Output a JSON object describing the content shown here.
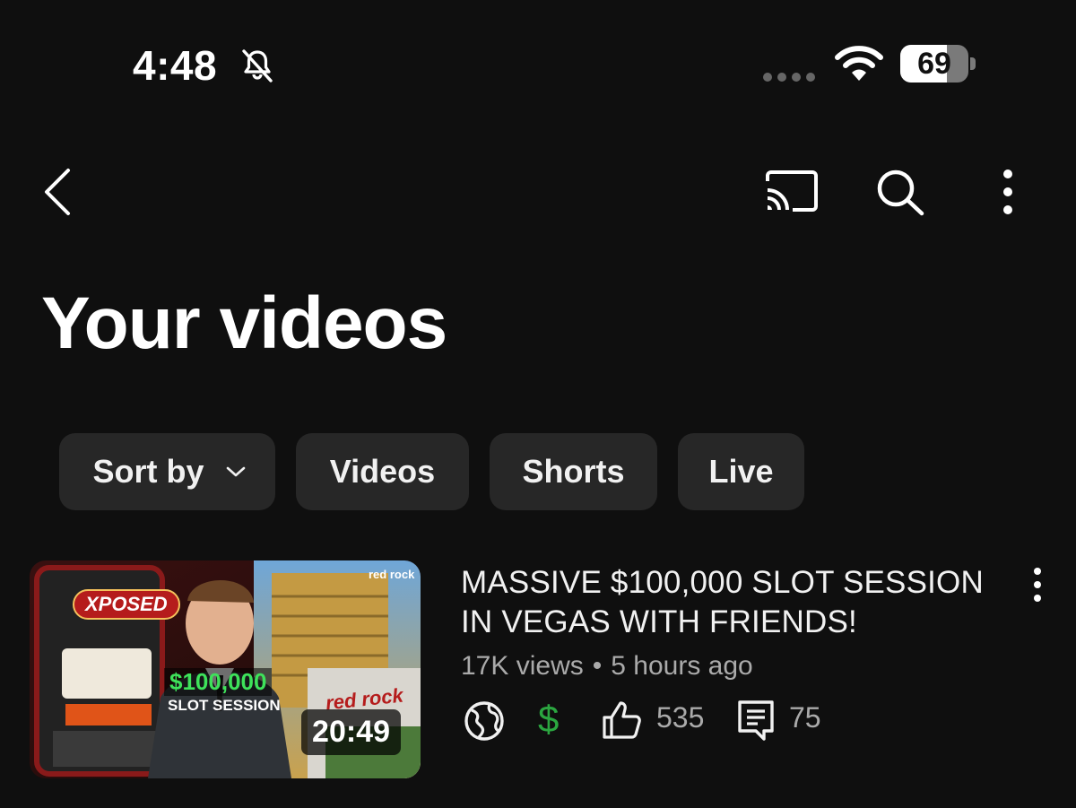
{
  "status_bar": {
    "time": "4:48",
    "battery": "69",
    "battery_level_percent": 69,
    "icons": [
      "bell-muted-icon",
      "cellular-icon",
      "wifi-icon",
      "battery-icon"
    ]
  },
  "top_bar": {
    "icons": [
      "back-chevron-icon",
      "cast-icon",
      "search-icon",
      "more-vertical-icon"
    ]
  },
  "page": {
    "title": "Your videos"
  },
  "chips": {
    "sort_by": "Sort by",
    "videos": "Videos",
    "shorts": "Shorts",
    "live": "Live"
  },
  "video": {
    "title": "MASSIVE $100,000 SLOT SESSION IN VEGAS WITH FRIENDS!",
    "views": "17K views",
    "separator": "•",
    "age": "5 hours ago",
    "duration": "20:49",
    "likes": "535",
    "comments": "75",
    "monetization_symbol": "$",
    "visibility_icon": "globe-icon",
    "thumbnail": {
      "badge": "XPOSED",
      "amount": "$100,000",
      "session": "SLOT SESSION",
      "brand_small": "red rock",
      "brand_large": "red rock"
    },
    "colors": {
      "monetization": "#2ba640"
    }
  }
}
